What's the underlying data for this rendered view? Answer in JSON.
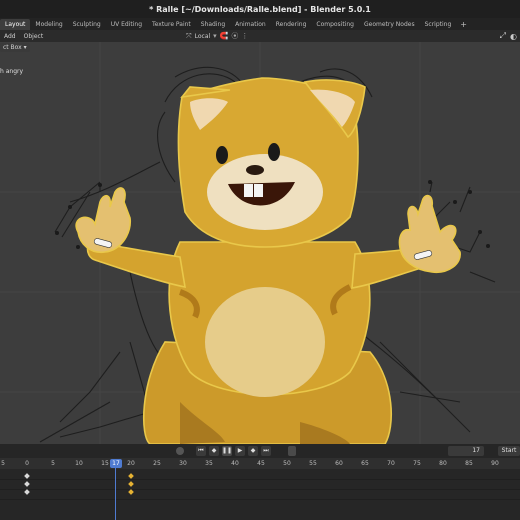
{
  "window": {
    "title": "* Ralle [~/Downloads/Ralle.blend] - Blender 5.0.1"
  },
  "workspaces": [
    {
      "label": "Layout",
      "active": true
    },
    {
      "label": "Modeling"
    },
    {
      "label": "Sculpting"
    },
    {
      "label": "UV Editing"
    },
    {
      "label": "Texture Paint"
    },
    {
      "label": "Shading"
    },
    {
      "label": "Animation"
    },
    {
      "label": "Rendering"
    },
    {
      "label": "Compositing"
    },
    {
      "label": "Geometry Nodes"
    },
    {
      "label": "Scripting"
    }
  ],
  "add_tab_label": "+",
  "header": {
    "menu_add": "Add",
    "menu_object": "Object",
    "orientation": "Local",
    "select_mode": "ct Box"
  },
  "viewport": {
    "overlay_text": "h angry"
  },
  "playback": {
    "current_frame": "17",
    "start_label": "Start"
  },
  "timeline": {
    "ticks": [
      "5",
      "0",
      "5",
      "10",
      "15",
      "20",
      "25",
      "30",
      "35",
      "40",
      "45",
      "50",
      "55",
      "60",
      "65",
      "70",
      "75",
      "80",
      "85",
      "90"
    ],
    "playhead_label": "17"
  },
  "colors": {
    "viewport_bg": "#3d3d3d",
    "selection_outline": "#e9c84a",
    "playhead": "#4f7bd1",
    "keyframe_selected": "#e6b233"
  }
}
